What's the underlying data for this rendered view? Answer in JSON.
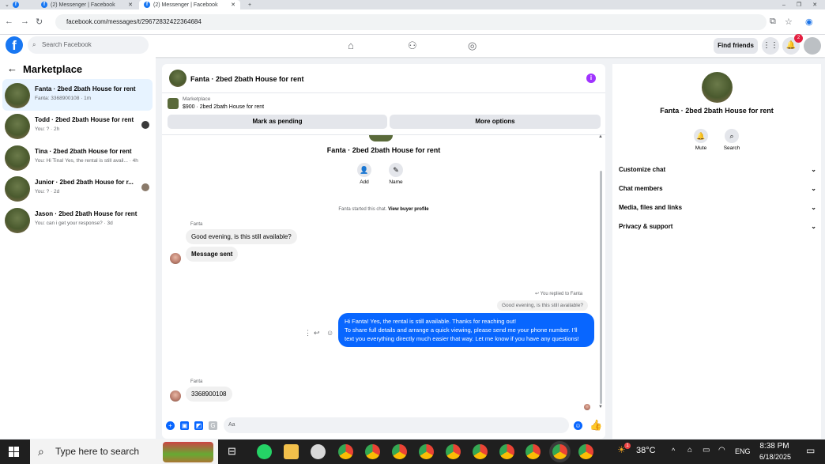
{
  "browser": {
    "tabs": [
      {
        "label": ""
      },
      {
        "label": "(2) Messenger | Facebook"
      },
      {
        "label": "(2) Messenger | Facebook"
      }
    ],
    "url": "facebook.com/messages/t/29672832422364684"
  },
  "fbnav": {
    "search_placeholder": "Search Facebook",
    "find_friends": "Find friends",
    "notif_count": "2"
  },
  "sidebar": {
    "title": "Marketplace",
    "chats": [
      {
        "name": "Fanta · 2bed 2bath House for rent",
        "preview": "Fanta: 3368900108 · 1m"
      },
      {
        "name": "Todd · 2bed 2bath House for rent",
        "preview": "You: ? · 2h"
      },
      {
        "name": "Tina · 2bed 2bath House for rent",
        "preview": "You: Hi Tina! Yes, the rental is still avail... · 4h"
      },
      {
        "name": "Junior · 2bed 2bath House for r...",
        "preview": "You: ? · 2d"
      },
      {
        "name": "Jason · 2bed 2bath House for rent",
        "preview": "You: can i get your response? · 3d"
      }
    ]
  },
  "conversation": {
    "title": "Fanta · 2bed 2bath House for rent",
    "marketplace_label": "Marketplace",
    "listing": "$900 · 2bed 2bath House for rent",
    "mark_pending": "Mark as pending",
    "more_options": "More options",
    "add_label": "Add",
    "name_label": "Name",
    "started_text": "Fanta started this chat.",
    "view_profile": "View buyer profile",
    "sender_name": "Fanta",
    "msg1": "Good evening, is this still available?",
    "msg2": "Message sent",
    "replied_to": "You replied to Fanta",
    "quoted": "Good evening, is this still available?",
    "reply": "Hi Fanta! Yes, the rental is still available. Thanks for reaching out!\nTo share full details and arrange a quick viewing, please send me your phone number. I'll text you everything directly much easier that way. Let me know if you have any questions!",
    "sender_name2": "Fanta",
    "msg3": "3368900108",
    "composer_placeholder": "Aa"
  },
  "rightpanel": {
    "title": "Fanta · 2bed 2bath House for rent",
    "mute": "Mute",
    "search": "Search",
    "items": [
      "Customize chat",
      "Chat members",
      "Media, files and links",
      "Privacy & support"
    ]
  },
  "taskbar": {
    "search_placeholder": "Type here to search",
    "temp": "38°C",
    "lang": "ENG",
    "time": "8:38 PM",
    "date": "6/18/2025",
    "weather_badge": "1"
  },
  "colors": {
    "fb_blue": "#1877f2",
    "messenger_blue": "#0866ff",
    "info_purple": "#a033ff"
  }
}
